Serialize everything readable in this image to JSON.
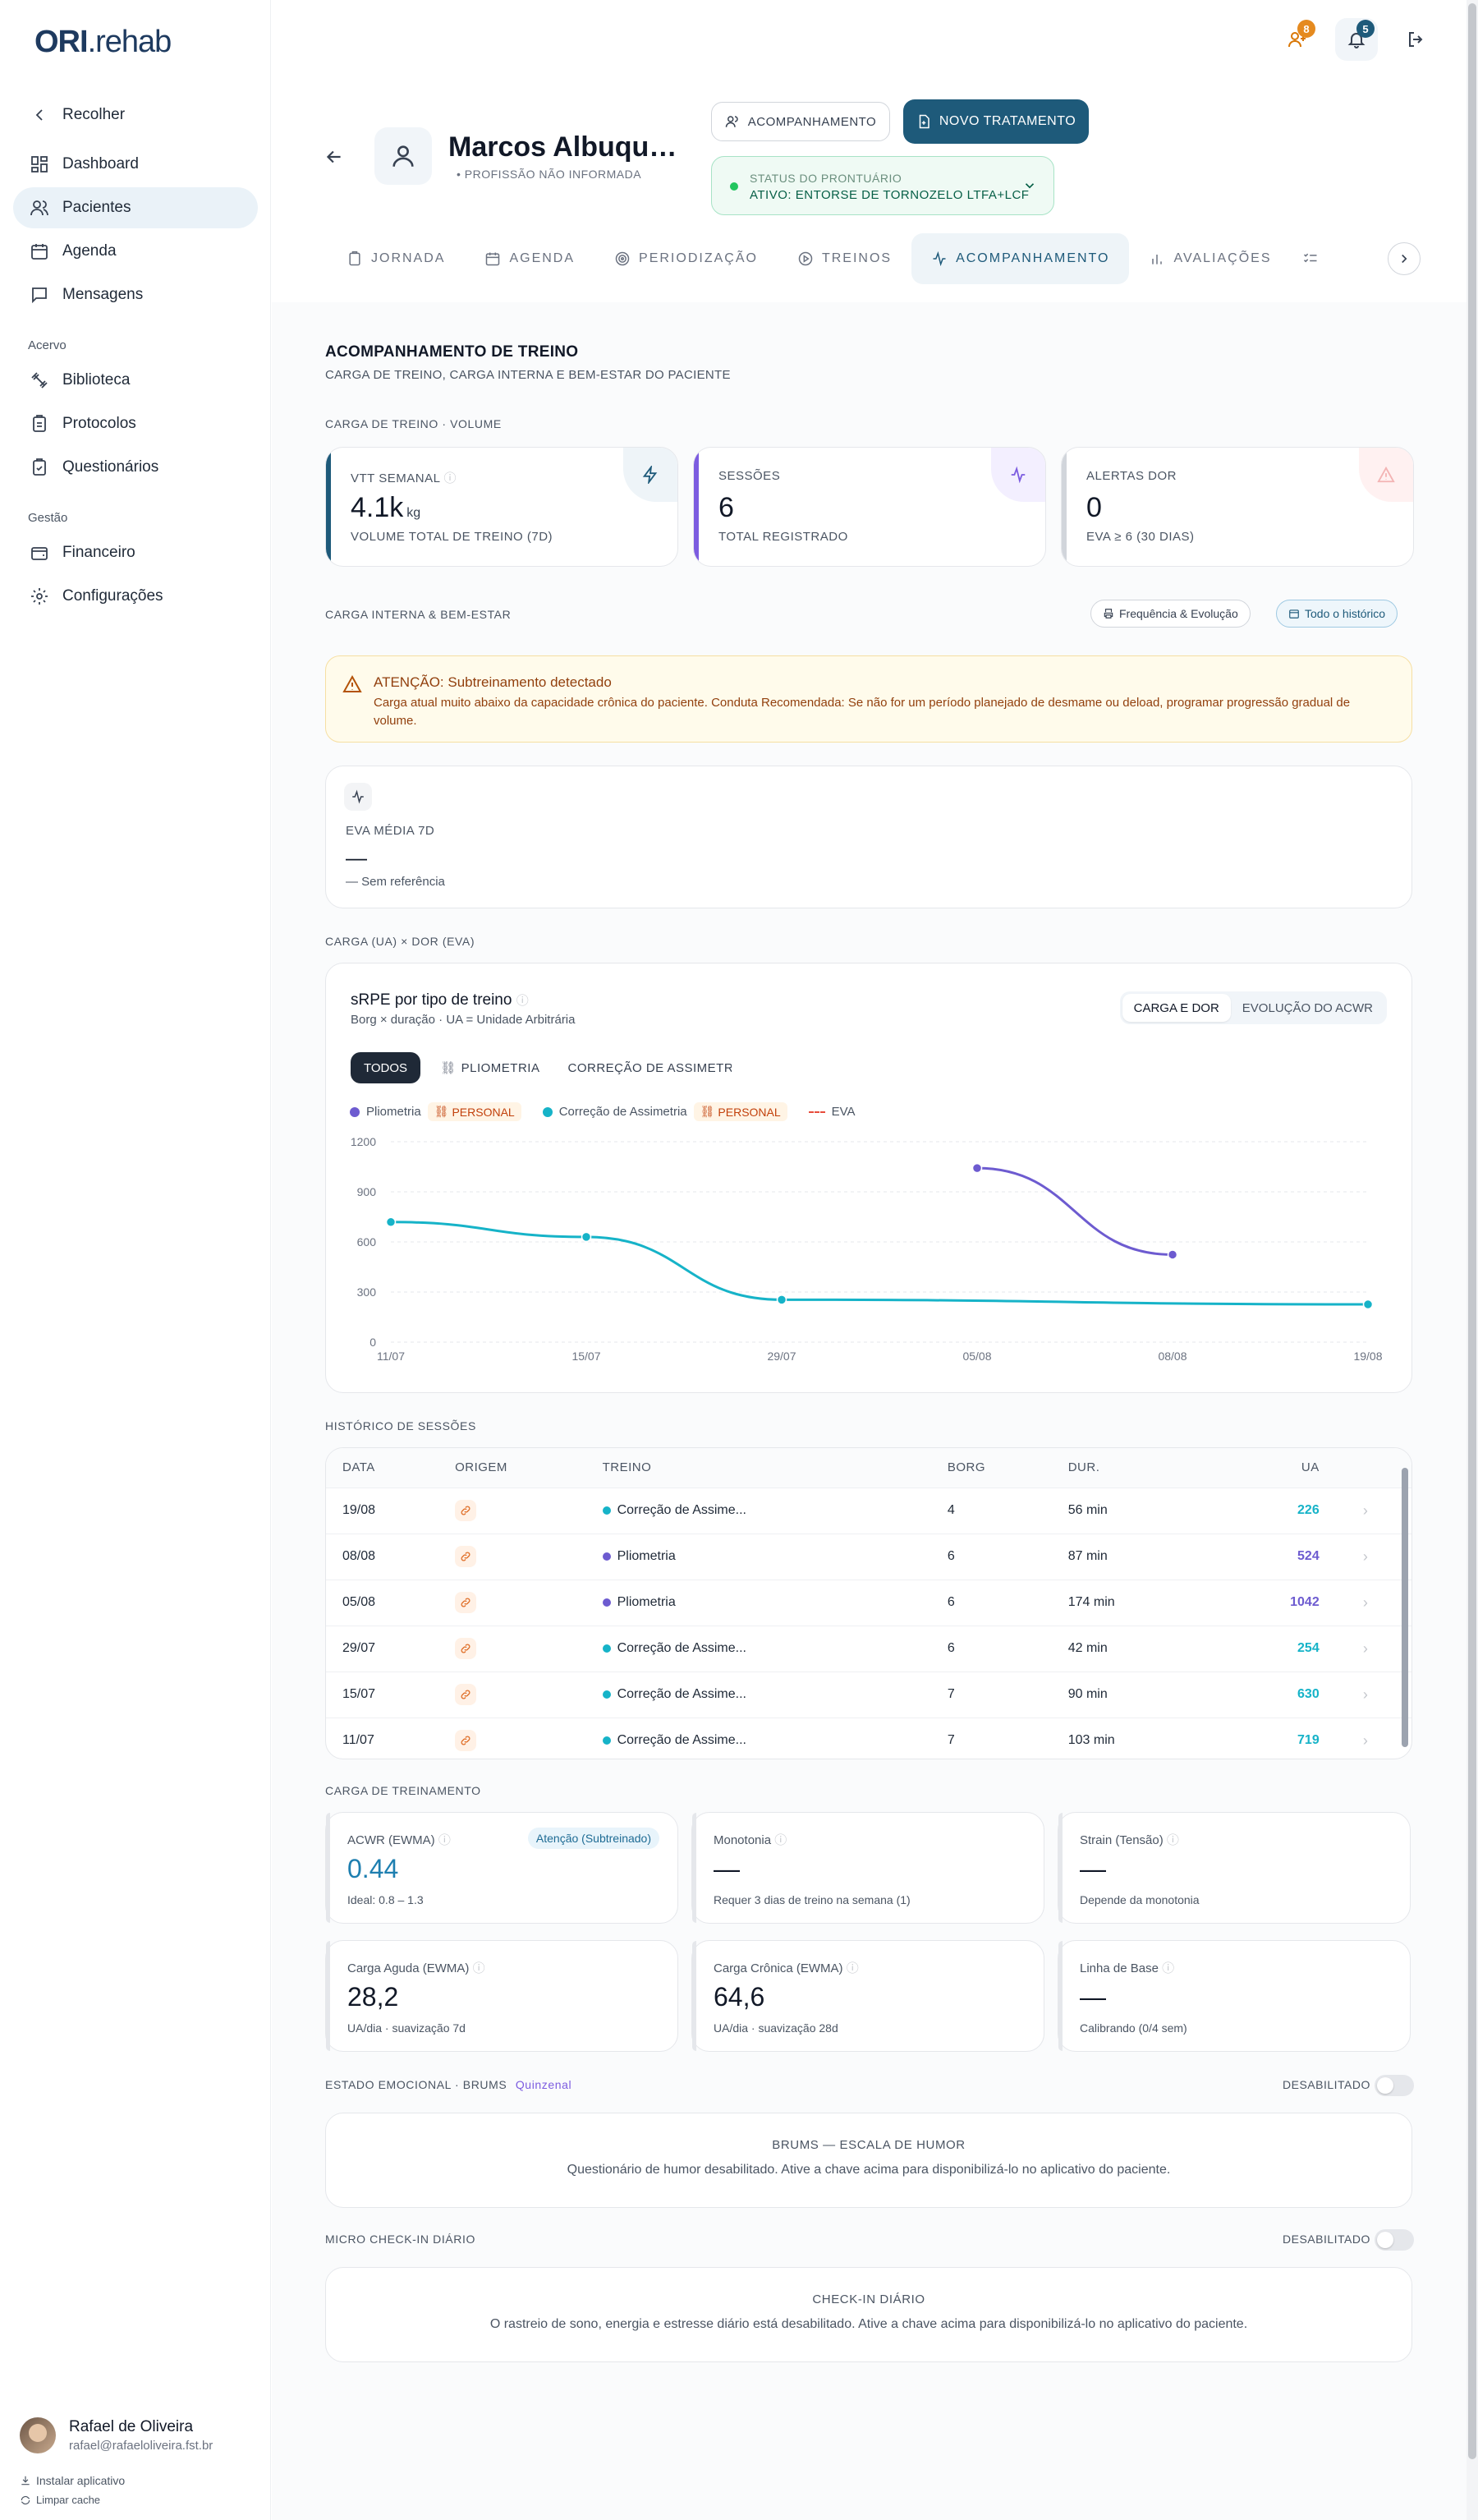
{
  "app": {
    "logo_main": "ORI",
    "logo_sub": ".rehab",
    "notif_people_count": "8",
    "notif_bell_count": "5"
  },
  "sidebar": {
    "collapse": "Recolher",
    "items": [
      {
        "label": "Dashboard"
      },
      {
        "label": "Pacientes"
      },
      {
        "label": "Agenda"
      },
      {
        "label": "Mensagens"
      }
    ],
    "section_acervo": "Acervo",
    "acervo_items": [
      {
        "label": "Biblioteca"
      },
      {
        "label": "Protocolos"
      },
      {
        "label": "Questionários"
      }
    ],
    "section_gestao": "Gestão",
    "gestao_items": [
      {
        "label": "Financeiro"
      },
      {
        "label": "Configurações"
      }
    ],
    "user_name": "Rafael de Oliveira",
    "user_email": "rafael@rafaeloliveira.fst.br",
    "install_app": "Instalar aplicativo",
    "clear_cache": "Limpar cache"
  },
  "patient": {
    "name": "Marcos Albuquerque",
    "profession": "PROFISSÃO NÃO INFORMADA",
    "btn_follow": "ACOMPANHAMENTO",
    "btn_new": "NOVO TRATAMENTO",
    "status_label": "STATUS DO PRONTUÁRIO",
    "status_value": "ATIVO: ENTORSE DE TORNOZELO LTFA+LCF"
  },
  "tabs": [
    {
      "label": "JORNADA"
    },
    {
      "label": "AGENDA"
    },
    {
      "label": "PERIODIZAÇÃO"
    },
    {
      "label": "TREINOS"
    },
    {
      "label": "ACOMPANHAMENTO"
    },
    {
      "label": "AVALIAÇÕES"
    }
  ],
  "section": {
    "title": "ACOMPANHAMENTO DE TREINO",
    "subtitle": "CARGA DE TREINO, CARGA INTERNA E BEM-ESTAR DO PACIENTE",
    "volume_label": "CARGA DE TREINO · VOLUME",
    "internal_label": "CARGA INTERNA & BEM-ESTAR",
    "btn_freq": "Frequência & Evolução",
    "btn_history": "Todo o histórico",
    "chart_label": "CARGA (UA) × DOR (EVA)",
    "history_label": "HISTÓRICO DE SESSÕES",
    "load_label": "CARGA DE TREINAMENTO",
    "brums_label": "ESTADO EMOCIONAL · BRUMS",
    "brums_freq": "Quinzenal",
    "micro_label": "MICRO CHECK-IN DIÁRIO"
  },
  "kpis": [
    {
      "label": "VTT SEMANAL",
      "value": "4.1k",
      "unit": "kg",
      "sub": "VOLUME TOTAL DE TREINO (7D)",
      "color": "#1e5a7a",
      "icon": "zap-icon"
    },
    {
      "label": "SESSÕES",
      "value": "6",
      "unit": "",
      "sub": "TOTAL REGISTRADO",
      "color": "#7c5ce0",
      "icon": "activity-icon"
    },
    {
      "label": "ALERTAS DOR",
      "value": "0",
      "unit": "",
      "sub": "EVA ≥ 6 (30 DIAS)",
      "color": "#d1d5db",
      "icon": "alert-triangle-icon"
    }
  ],
  "alert": {
    "title": "ATENÇÃO: Subtreinamento detectado",
    "text": "Carga atual muito abaixo da capacidade crônica do paciente. Conduta Recomendada: Se não for um período planejado de desmame ou deload, programar progressão gradual de volume."
  },
  "eva": {
    "label": "EVA MÉDIA 7D",
    "value": "—",
    "ref": "— Sem referência"
  },
  "chart_panel": {
    "title": "sRPE por tipo de treino",
    "subtitle": "Borg × duração · UA = Unidade Arbitrária",
    "toggle_a": "CARGA E DOR",
    "toggle_b": "EVOLUÇÃO DO ACWR",
    "filters": [
      "TODOS",
      "PLIOMETRIA",
      "CORREÇÃO DE ASSIMETRIA"
    ],
    "legend_tag": "PERSONAL"
  },
  "chart_data": {
    "type": "line",
    "categories": [
      "11/07",
      "15/07",
      "29/07",
      "05/08",
      "08/08",
      "19/08"
    ],
    "ylim": [
      0,
      1200
    ],
    "yticks": [
      0,
      300,
      600,
      900,
      1200
    ],
    "series": [
      {
        "name": "Pliometria",
        "color": "#6d5bd0",
        "values": [
          null,
          null,
          null,
          1042,
          524,
          null
        ]
      },
      {
        "name": "Correção de Assimetria",
        "color": "#16b3c8",
        "values": [
          719,
          630,
          254,
          null,
          null,
          226
        ]
      },
      {
        "name": "EVA",
        "color": "#e74c3c",
        "dashed": true,
        "values": []
      }
    ]
  },
  "history": {
    "headers": [
      "DATA",
      "ORIGEM",
      "TREINO",
      "BORG",
      "DUR.",
      "UA"
    ],
    "rows": [
      {
        "date": "19/08",
        "training": "Correção de Assime...",
        "color": "#16b3c8",
        "borg": "4",
        "dur": "56 min",
        "ua": "226"
      },
      {
        "date": "08/08",
        "training": "Pliometria",
        "color": "#6d5bd0",
        "borg": "6",
        "dur": "87 min",
        "ua": "524"
      },
      {
        "date": "05/08",
        "training": "Pliometria",
        "color": "#6d5bd0",
        "borg": "6",
        "dur": "174 min",
        "ua": "1042"
      },
      {
        "date": "29/07",
        "training": "Correção de Assime...",
        "color": "#16b3c8",
        "borg": "6",
        "dur": "42 min",
        "ua": "254"
      },
      {
        "date": "15/07",
        "training": "Correção de Assime...",
        "color": "#16b3c8",
        "borg": "7",
        "dur": "90 min",
        "ua": "630"
      },
      {
        "date": "11/07",
        "training": "Correção de Assime...",
        "color": "#16b3c8",
        "borg": "7",
        "dur": "103 min",
        "ua": "719"
      }
    ]
  },
  "load_cards": [
    {
      "label": "ACWR (EWMA)",
      "badge": "Atenção (Subtreinado)",
      "value": "0.44",
      "sub": "Ideal: 0.8 – 1.3"
    },
    {
      "label": "Monotonia",
      "value": "—",
      "sub": "Requer 3 dias de treino na semana (1)"
    },
    {
      "label": "Strain (Tensão)",
      "value": "—",
      "sub": "Depende da monotonia"
    },
    {
      "label": "Carga Aguda (EWMA)",
      "value": "28,2",
      "sub": "UA/dia · suavização 7d"
    },
    {
      "label": "Carga Crônica (EWMA)",
      "value": "64,6",
      "sub": "UA/dia · suavização 28d"
    },
    {
      "label": "Linha de Base",
      "value": "—",
      "sub": "Calibrando (0/4 sem)"
    }
  ],
  "brums": {
    "toggle_label": "DESABILITADO",
    "title": "BRUMS — ESCALA DE HUMOR",
    "text": "Questionário de humor desabilitado. Ative a chave acima para disponibilizá-lo no aplicativo do paciente."
  },
  "micro": {
    "toggle_label": "DESABILITADO",
    "title": "CHECK-IN DIÁRIO",
    "text": "O rastreio de sono, energia e estresse diário está desabilitado. Ative a chave acima para disponibilizá-lo no aplicativo do paciente."
  }
}
